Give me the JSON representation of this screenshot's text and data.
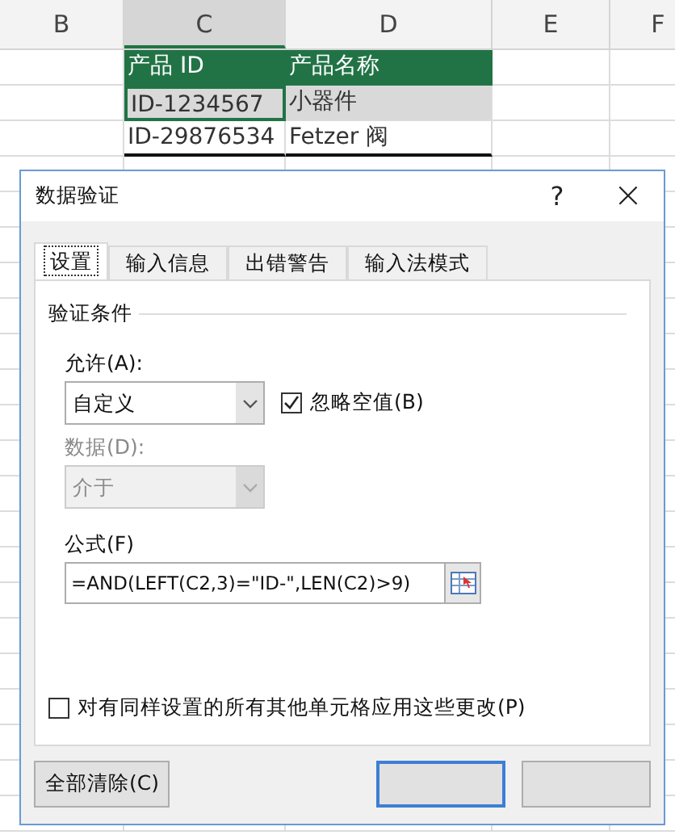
{
  "sheet": {
    "columns": [
      {
        "label": "B",
        "selected": false
      },
      {
        "label": "C",
        "selected": true
      },
      {
        "label": "D",
        "selected": false
      },
      {
        "label": "E",
        "selected": false
      },
      {
        "label": "F",
        "selected": false
      }
    ],
    "rows": [
      {
        "kind": "header",
        "cells": [
          "",
          "产品 ID",
          "产品名称"
        ]
      },
      {
        "kind": "data",
        "cells": [
          "",
          "ID-1234567",
          "小器件"
        ]
      },
      {
        "kind": "data",
        "cells": [
          "",
          "ID-29876534",
          "Fetzer 阀"
        ]
      }
    ]
  },
  "dialog": {
    "title": "数据验证",
    "help": "?",
    "close": "×",
    "tabs": [
      {
        "label": "设置",
        "selected": true
      },
      {
        "label": "输入信息",
        "selected": false
      },
      {
        "label": "出错警告",
        "selected": false
      },
      {
        "label": "输入法模式",
        "selected": false
      }
    ],
    "group": "验证条件",
    "allow": {
      "label": "允许(A):",
      "value": "自定义",
      "disabled": false
    },
    "ignore_blank": {
      "label": "忽略空值(B)",
      "checked": true
    },
    "data": {
      "label": "数据(D):",
      "value": "介于",
      "disabled": true
    },
    "formula": {
      "label": "公式(F)",
      "value": "=AND(LEFT(C2,3)=\"ID-\",LEN(C2)>9)"
    },
    "apply_all": {
      "label": "对有同样设置的所有其他单元格应用这些更改(P)",
      "checked": false
    },
    "clear_button": "全部清除(C)"
  }
}
